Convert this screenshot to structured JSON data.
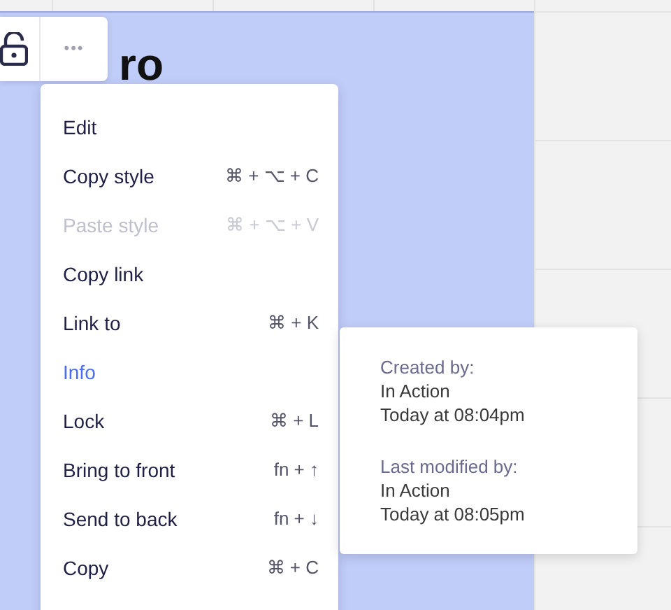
{
  "board": {
    "heading": "ro"
  },
  "toolbar": {
    "more_button": "•••"
  },
  "menu": [
    {
      "label": "Edit",
      "disabled": false,
      "selected": false
    },
    {
      "label": "Copy style",
      "shortcut": "⌘ + ⌥ + C",
      "disabled": false,
      "selected": false
    },
    {
      "label": "Paste style",
      "shortcut": "⌘ + ⌥ + V",
      "disabled": true,
      "selected": false
    },
    {
      "label": "Copy link",
      "disabled": false,
      "selected": false
    },
    {
      "label": "Link to",
      "shortcut": "⌘ + K",
      "disabled": false,
      "selected": false
    },
    {
      "label": "Info",
      "disabled": false,
      "selected": true
    },
    {
      "label": "Lock",
      "shortcut": "⌘ + L",
      "disabled": false,
      "selected": false
    },
    {
      "label": "Bring to front",
      "shortcut": "fn + ↑",
      "disabled": false,
      "selected": false
    },
    {
      "label": "Send to back",
      "shortcut": "fn + ↓",
      "disabled": false,
      "selected": false
    },
    {
      "label": "Copy",
      "shortcut": "⌘ + C",
      "disabled": false,
      "selected": false
    }
  ],
  "info": [
    {
      "label": "Created by:",
      "name": "In Action",
      "time": "Today at 08:04pm"
    },
    {
      "label": "Last modified by:",
      "name": "In Action",
      "time": "Today at 08:05pm"
    }
  ]
}
